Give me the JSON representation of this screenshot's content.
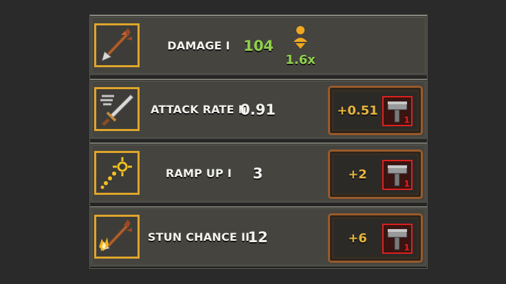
{
  "upgrades": [
    {
      "name": "DAMAGE I",
      "value": "104",
      "value_color": "#8fd14a",
      "multiplier": "1.6x",
      "icon": "arrow-icon"
    },
    {
      "name": "ATTACK RATE II",
      "value": "0.91",
      "button_label": "+0.51",
      "cost": "1",
      "icon": "sword-icon"
    },
    {
      "name": "RAMP UP I",
      "value": "3",
      "button_label": "+2",
      "cost": "1",
      "icon": "crosshair-dots-icon"
    },
    {
      "name": "STUN CHANCE II",
      "value": "12",
      "button_label": "+6",
      "cost": "1",
      "icon": "flaming-arrow-icon"
    }
  ],
  "colors": {
    "icon_border": "#e0a62a",
    "button_text": "#e8b53c",
    "cost_border": "#e02020",
    "highlight_value": "#8fd14a"
  }
}
